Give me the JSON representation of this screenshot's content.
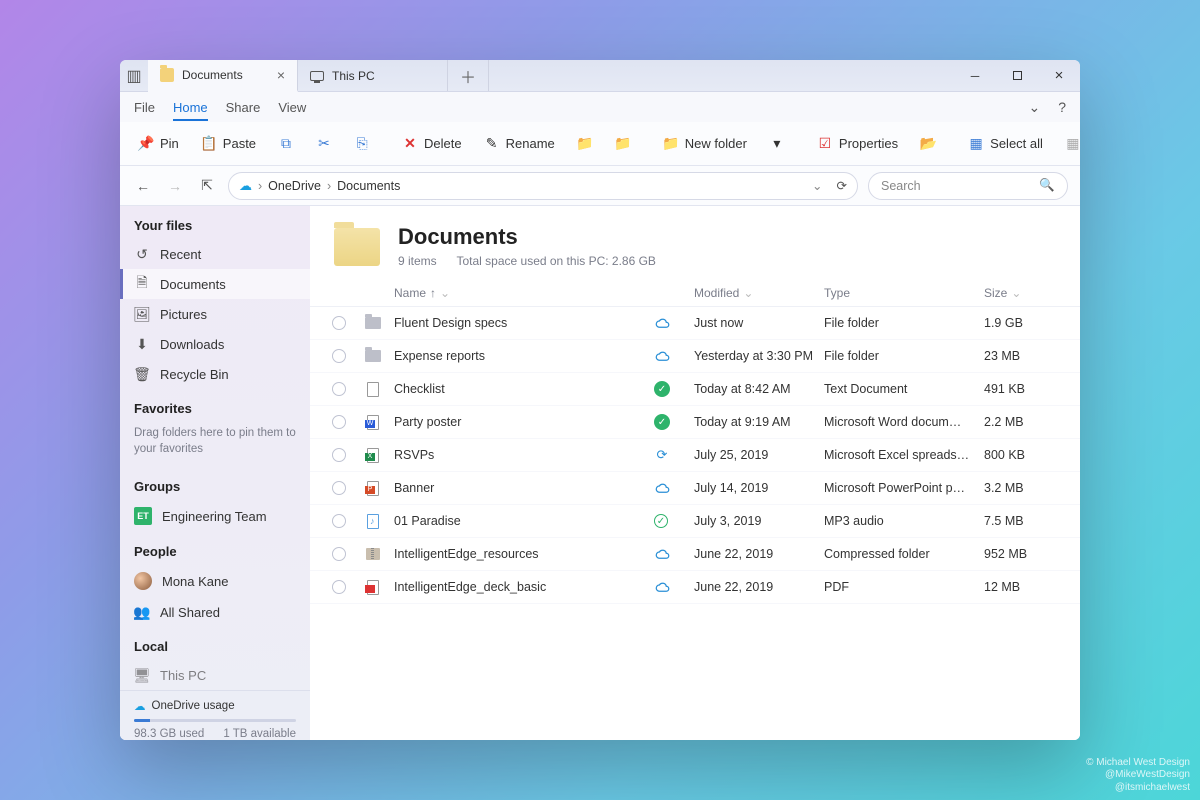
{
  "tabs": [
    {
      "label": "Documents",
      "active": true
    },
    {
      "label": "This PC",
      "active": false
    }
  ],
  "menu": {
    "file": "File",
    "home": "Home",
    "share": "Share",
    "view": "View"
  },
  "ribbon": {
    "pin": "Pin",
    "paste": "Paste",
    "delete": "Delete",
    "rename": "Rename",
    "newfolder": "New folder",
    "properties": "Properties",
    "selectall": "Select all"
  },
  "breadcrumb": {
    "root": "OneDrive",
    "current": "Documents"
  },
  "search": {
    "placeholder": "Search"
  },
  "sidebar": {
    "sections": {
      "yourfiles": "Your files",
      "favorites": "Favorites",
      "groups": "Groups",
      "people": "People",
      "local": "Local"
    },
    "items": {
      "recent": "Recent",
      "documents": "Documents",
      "pictures": "Pictures",
      "downloads": "Downloads",
      "recycle": "Recycle Bin",
      "fav_hint": "Drag folders here to pin them to your favorites",
      "group1_badge": "ET",
      "group1": "Engineering Team",
      "person1": "Mona Kane",
      "allshared": "All Shared",
      "thispc": "This PC"
    },
    "footer": {
      "label": "OneDrive usage",
      "used": "98.3 GB used",
      "avail": "1 TB available"
    }
  },
  "header": {
    "title": "Documents",
    "count": "9 items",
    "space": "Total space used on this PC: 2.86 GB"
  },
  "columns": {
    "name": "Name",
    "modified": "Modified",
    "type": "Type",
    "size": "Size"
  },
  "files": [
    {
      "name": "Fluent Design specs",
      "icon": "folder",
      "status": "cloud",
      "modified": "Just now",
      "type": "File folder",
      "size": "1.9 GB"
    },
    {
      "name": "Expense reports",
      "icon": "folder",
      "status": "cloud",
      "modified": "Yesterday at 3:30 PM",
      "type": "File folder",
      "size": "23 MB"
    },
    {
      "name": "Checklist",
      "icon": "doc",
      "status": "check",
      "modified": "Today at 8:42 AM",
      "type": "Text Document",
      "size": "491 KB"
    },
    {
      "name": "Party poster",
      "icon": "word",
      "status": "check",
      "modified": "Today at 9:19 AM",
      "type": "Microsoft Word docum…",
      "size": "2.2 MB"
    },
    {
      "name": "RSVPs",
      "icon": "excel",
      "status": "sync",
      "modified": "July 25, 2019",
      "type": "Microsoft Excel spreads…",
      "size": "800 KB"
    },
    {
      "name": "Banner",
      "icon": "ppt",
      "status": "cloud",
      "modified": "July 14, 2019",
      "type": "Microsoft PowerPoint p…",
      "size": "3.2 MB"
    },
    {
      "name": "01 Paradise",
      "icon": "audio",
      "status": "outline",
      "modified": "July 3, 2019",
      "type": "MP3 audio",
      "size": "7.5 MB"
    },
    {
      "name": "IntelligentEdge_resources",
      "icon": "zip",
      "status": "cloud",
      "modified": "June 22, 2019",
      "type": "Compressed folder",
      "size": "952 MB"
    },
    {
      "name": "IntelligentEdge_deck_basic",
      "icon": "pdf",
      "status": "cloud",
      "modified": "June 22, 2019",
      "type": "PDF",
      "size": "12 MB"
    }
  ],
  "attribution": {
    "line1": "© Michael West Design",
    "line2": "@MikeWestDesign",
    "line3": "@itsmichaelwest"
  }
}
